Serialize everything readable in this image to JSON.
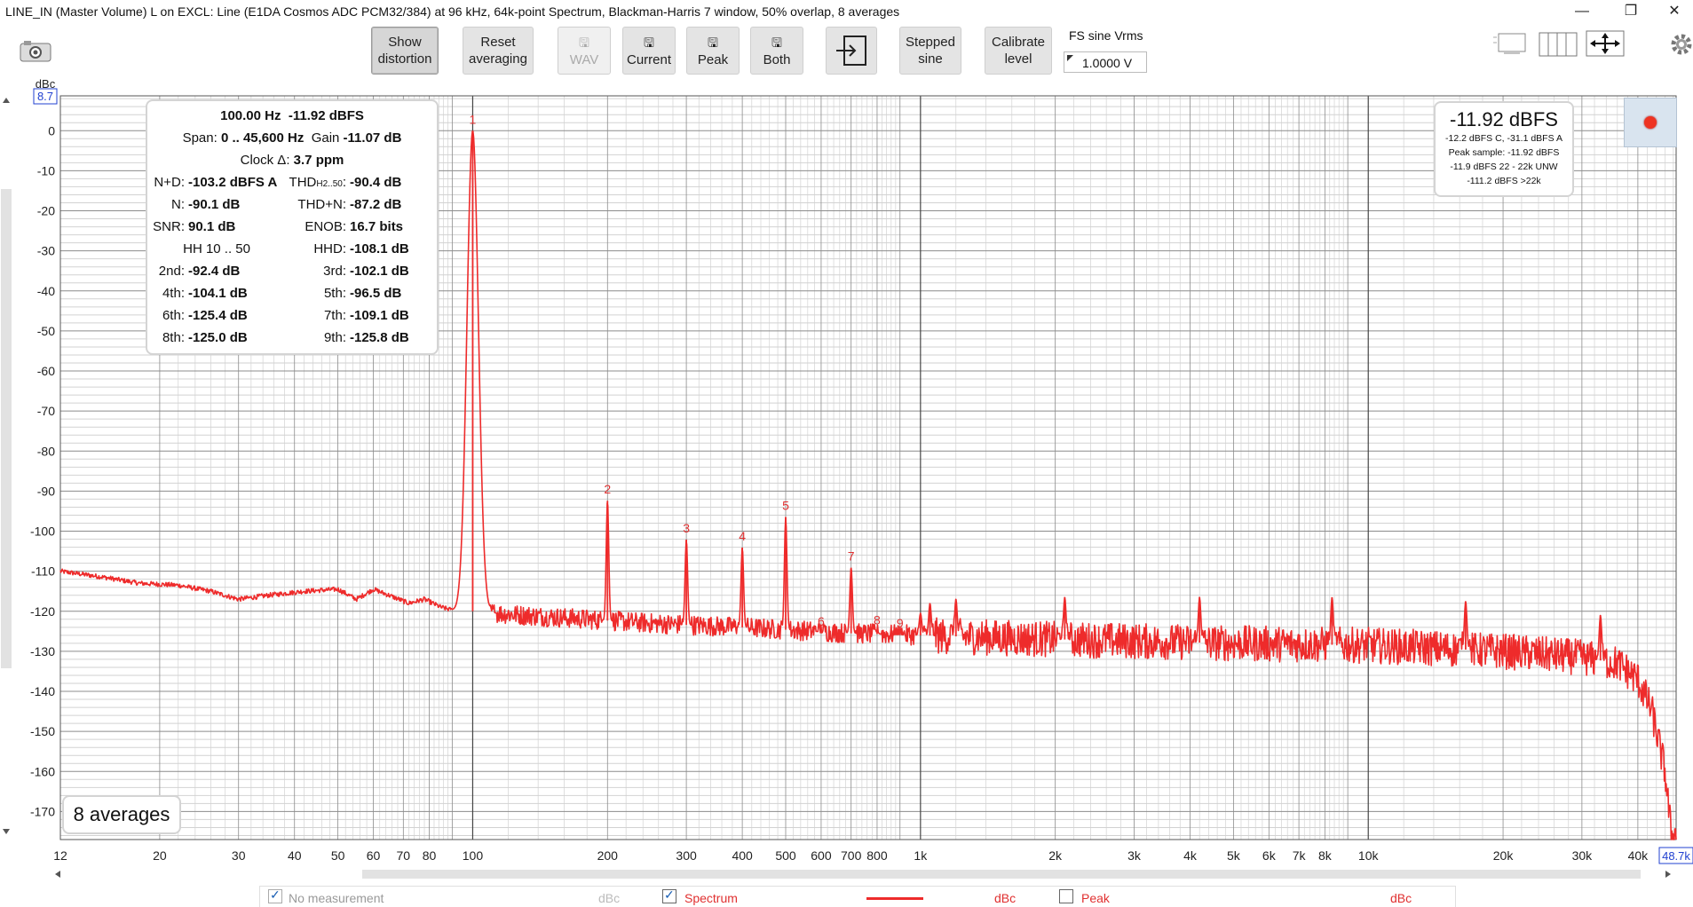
{
  "window": {
    "title": "LINE_IN (Master Volume) L on EXCL: Line (E1DA Cosmos ADC PCM32/384) at 96 kHz, 64k-point Spectrum, Blackman-Harris 7 window, 50% overlap, 8 averages",
    "min_glyph": "—",
    "restore_glyph": "❐",
    "close_glyph": "✕"
  },
  "toolbar": {
    "camera_icon": "camera-icon",
    "show_distortion": [
      "Show",
      "distortion"
    ],
    "reset_averaging": [
      "Reset",
      "averaging"
    ],
    "wav": "WAV",
    "current": "Current",
    "peak": "Peak",
    "both": "Both",
    "save_glyph": "🖫",
    "export_icon": "export-icon",
    "stepped_sine": [
      "Stepped",
      "sine"
    ],
    "calibrate_level": [
      "Calibrate",
      "level"
    ],
    "fs_label": "FS sine Vrms",
    "fs_value": "1.0000 V",
    "gear_icon": "gear-icon"
  },
  "stats": {
    "header_freq": "100.00 Hz",
    "header_level": "-11.92 dBFS",
    "span_label": "Span:",
    "span_value": "0 .. 45,600 Hz",
    "gain_label": "Gain",
    "gain_value": "-11.07 dB",
    "clock_label": "Clock Δ:",
    "clock_value": "3.7 ppm",
    "nd_label": "N+D:",
    "nd_value": "-103.2 dBFS A",
    "thd_label": "THD",
    "thd_sub": "H2..50",
    "thd_colon": ":",
    "thd_value": "-90.4 dB",
    "n_label": "N:",
    "n_value": "-90.1 dB",
    "thdn_label": "THD+N:",
    "thdn_value": "-87.2 dB",
    "snr_label": "SNR:",
    "snr_value": "90.1 dB",
    "enob_label": "ENOB:",
    "enob_value": "16.7 bits",
    "hh_label": "HH 10 .. 50",
    "hhd_label": "HHD:",
    "hhd_value": "-108.1 dB",
    "h2_label": "2nd:",
    "h2_value": "-92.4 dB",
    "h3_label": "3rd:",
    "h3_value": "-102.1 dB",
    "h4_label": "4th:",
    "h4_value": "-104.1 dB",
    "h5_label": "5th:",
    "h5_value": "-96.5 dB",
    "h6_label": "6th:",
    "h6_value": "-125.4 dB",
    "h7_label": "7th:",
    "h7_value": "-109.1 dB",
    "h8_label": "8th:",
    "h8_value": "-125.0 dB",
    "h9_label": "9th:",
    "h9_value": "-125.8 dB"
  },
  "level": {
    "main": "-11.92 dBFS",
    "line1": "-12.2 dBFS C, -31.1 dBFS A",
    "line2": "Peak sample: -11.92 dBFS",
    "line3": "-11.9 dBFS 22 - 22k UNW",
    "line4": "-111.2 dBFS >22k"
  },
  "averages_label": "8 averages",
  "legend": {
    "no_measurement": "No measurement",
    "no_measurement_unit": "dBc",
    "spectrum": "Spectrum",
    "spectrum_unit": "dBc",
    "peak": "Peak",
    "peak_unit": "dBc"
  },
  "chart_data": {
    "type": "line",
    "title": "",
    "xlabel": "",
    "ylabel": "dBc",
    "x_scale": "log",
    "xlim": [
      12,
      48700
    ],
    "ylim": [
      -177,
      8.7
    ],
    "ylim_max_label": "8.7",
    "xlim_max_label": "48.7k",
    "grid": true,
    "y_ticks": [
      0,
      -10,
      -20,
      -30,
      -40,
      -50,
      -60,
      -70,
      -80,
      -90,
      -100,
      -110,
      -120,
      -130,
      -140,
      -150,
      -160,
      -170
    ],
    "x_ticks": [
      {
        "v": 12,
        "label": "12"
      },
      {
        "v": 20,
        "label": "20"
      },
      {
        "v": 30,
        "label": "30"
      },
      {
        "v": 40,
        "label": "40"
      },
      {
        "v": 50,
        "label": "50"
      },
      {
        "v": 60,
        "label": "60"
      },
      {
        "v": 70,
        "label": "70"
      },
      {
        "v": 80,
        "label": "80"
      },
      {
        "v": 100,
        "label": "100"
      },
      {
        "v": 200,
        "label": "200"
      },
      {
        "v": 300,
        "label": "300"
      },
      {
        "v": 400,
        "label": "400"
      },
      {
        "v": 500,
        "label": "500"
      },
      {
        "v": 600,
        "label": "600"
      },
      {
        "v": 700,
        "label": "700"
      },
      {
        "v": 800,
        "label": "800"
      },
      {
        "v": 1000,
        "label": "1k"
      },
      {
        "v": 2000,
        "label": "2k"
      },
      {
        "v": 3000,
        "label": "3k"
      },
      {
        "v": 4000,
        "label": "4k"
      },
      {
        "v": 5000,
        "label": "5k"
      },
      {
        "v": 6000,
        "label": "6k"
      },
      {
        "v": 7000,
        "label": "7k"
      },
      {
        "v": 8000,
        "label": "8k"
      },
      {
        "v": 10000,
        "label": "10k"
      },
      {
        "v": 20000,
        "label": "20k"
      },
      {
        "v": 30000,
        "label": "30k"
      },
      {
        "v": 40000,
        "label": "40k"
      }
    ],
    "harmonic_markers": [
      {
        "label": "1",
        "x": 100,
        "y": 0
      },
      {
        "label": "2",
        "x": 200,
        "y": -92.4
      },
      {
        "label": "3",
        "x": 300,
        "y": -102.1
      },
      {
        "label": "4",
        "x": 400,
        "y": -104.1
      },
      {
        "label": "5",
        "x": 500,
        "y": -96.5
      },
      {
        "label": "6",
        "x": 600,
        "y": -125.4
      },
      {
        "label": "7",
        "x": 700,
        "y": -109.1
      },
      {
        "label": "8",
        "x": 800,
        "y": -125.0
      },
      {
        "label": "9",
        "x": 900,
        "y": -125.8
      }
    ],
    "series": [
      {
        "name": "Spectrum",
        "color": "#ee2b2b",
        "floor": [
          [
            12,
            -110
          ],
          [
            15,
            -111.5
          ],
          [
            18,
            -113
          ],
          [
            22,
            -113.5
          ],
          [
            26,
            -115
          ],
          [
            30,
            -117
          ],
          [
            35,
            -116
          ],
          [
            42,
            -115
          ],
          [
            50,
            -114.5
          ],
          [
            55,
            -117
          ],
          [
            60,
            -114.5
          ],
          [
            65,
            -116
          ],
          [
            72,
            -118
          ],
          [
            78,
            -117
          ],
          [
            85,
            -119
          ],
          [
            92,
            -120
          ],
          [
            100,
            -120
          ],
          [
            130,
            -121
          ],
          [
            180,
            -122
          ],
          [
            250,
            -123
          ],
          [
            400,
            -124
          ],
          [
            700,
            -125.5
          ],
          [
            1000,
            -126
          ],
          [
            2000,
            -127
          ],
          [
            5000,
            -128
          ],
          [
            10000,
            -128.5
          ],
          [
            20000,
            -130
          ],
          [
            30000,
            -131.5
          ],
          [
            36000,
            -133
          ],
          [
            40000,
            -137
          ],
          [
            43000,
            -145
          ],
          [
            46000,
            -160
          ],
          [
            47500,
            -176
          ]
        ],
        "peaks": [
          [
            100,
            0
          ],
          [
            200,
            -92.4
          ],
          [
            300,
            -102.1
          ],
          [
            400,
            -104.1
          ],
          [
            500,
            -96.5
          ],
          [
            600,
            -125.4
          ],
          [
            700,
            -109.1
          ],
          [
            800,
            -125
          ],
          [
            900,
            -125.8
          ],
          [
            1000,
            -120.5
          ],
          [
            1050,
            -118
          ],
          [
            1200,
            -117
          ],
          [
            2100,
            -116.5
          ],
          [
            4200,
            -116.5
          ],
          [
            8300,
            -116.5
          ],
          [
            16500,
            -117.5
          ],
          [
            33000,
            -121
          ]
        ]
      }
    ]
  },
  "colors": {
    "trace": "#ee2b2b",
    "grid_major": "#8c8c8c",
    "grid_minor": "#d2d2d2",
    "marker_text": "#e03030",
    "axis_limit_box": "#2040d0"
  }
}
